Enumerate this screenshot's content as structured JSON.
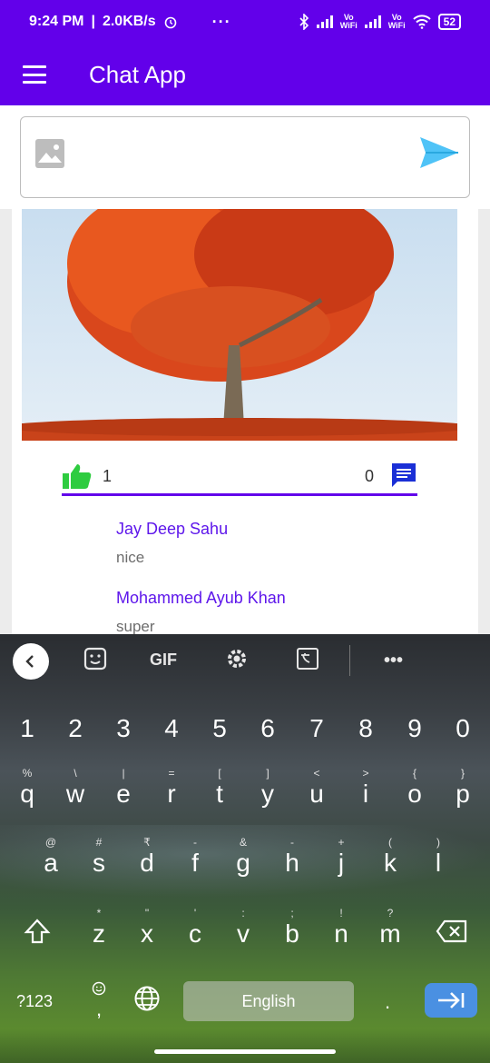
{
  "status_bar": {
    "time": "9:24 PM",
    "speed": "2.0KB/s",
    "more": "···",
    "vowifi_top": "Vo",
    "vowifi_bottom": "WiFi",
    "battery": "52"
  },
  "app_bar": {
    "title": "Chat App"
  },
  "composer": {
    "image_icon": "image-icon",
    "send_icon": "send-icon"
  },
  "post": {
    "likes": "1",
    "comments_count": "0",
    "comments": [
      {
        "author": "Jay Deep Sahu",
        "text": "nice"
      },
      {
        "author": "Mohammed Ayub Khan",
        "text": "super"
      }
    ]
  },
  "keyboard": {
    "toolbar": {
      "gif": "GIF"
    },
    "numbers": [
      "1",
      "2",
      "3",
      "4",
      "5",
      "6",
      "7",
      "8",
      "9",
      "0"
    ],
    "row1": {
      "keys": [
        "q",
        "w",
        "e",
        "r",
        "t",
        "y",
        "u",
        "i",
        "o",
        "p"
      ],
      "alts": [
        "%",
        "\\",
        "|",
        "=",
        "[",
        "]",
        "<",
        ">",
        "{",
        "}"
      ]
    },
    "row2": {
      "keys": [
        "a",
        "s",
        "d",
        "f",
        "g",
        "h",
        "j",
        "k",
        "l"
      ],
      "alts": [
        "@",
        "#",
        "₹",
        "-",
        "&",
        "-",
        "+",
        "(",
        ")"
      ]
    },
    "row3": {
      "keys": [
        "z",
        "x",
        "c",
        "v",
        "b",
        "n",
        "m"
      ],
      "alts": [
        "*",
        "\"",
        "'",
        ":",
        ";",
        "!",
        "?"
      ]
    },
    "sym_label": "?123",
    "comma": ",",
    "period": ".",
    "space_label": "English"
  },
  "colors": {
    "primary": "#6200ea",
    "author": "#5e17eb",
    "like": "#2ecc40",
    "send": "#4fc3f7",
    "comment_icon": "#1a2fd6"
  }
}
